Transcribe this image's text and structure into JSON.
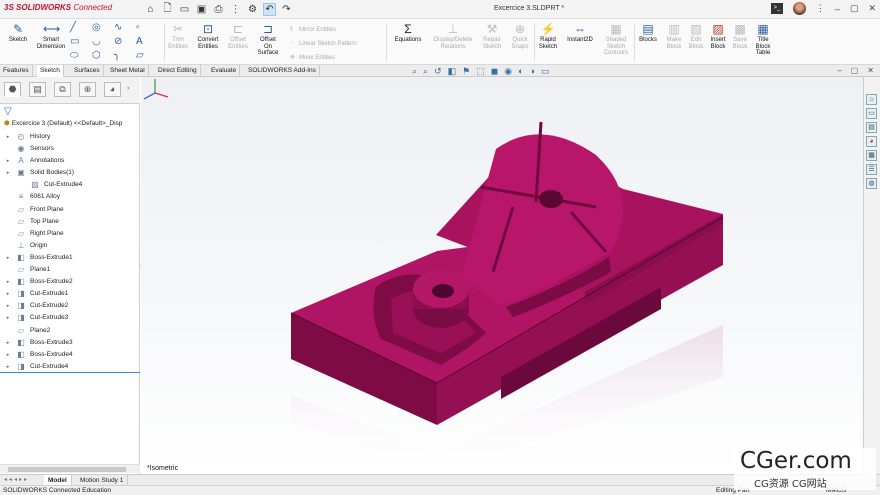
{
  "app": {
    "logo_prefix": "3S",
    "logo_name": "SOLIDWORKS",
    "logo_suffix": "Connected",
    "document_title": "Excercice 3.SLDPRT *"
  },
  "quick_access": [
    "home-icon",
    "new-file-icon",
    "open-icon",
    "save-icon",
    "print-icon",
    "traffic-light-icon",
    "options-icon",
    "undo-icon",
    "redo-icon"
  ],
  "ribbon": {
    "sketch": "Sketch",
    "smart_dimension": "Smart\nDimension",
    "trim": "Trim\nEntities",
    "convert": "Convert\nEntities",
    "offset": "Offset\nEntities",
    "offset_surface": "Offset\nOn\nSurface",
    "mirror": "Mirror Entities",
    "linear_pattern": "Linear Sketch Pattern",
    "move": "Move Entities",
    "equations": "Equations",
    "display_delete": "Display/Delete\nRelations",
    "repair": "Repair\nSketch",
    "quick_snaps": "Quick\nSnaps",
    "rapid_sketch": "Rapid\nSketch",
    "instant2d": "Instant2D",
    "shaded_contours": "Shaded\nSketch\nContours",
    "blocks": "Blocks",
    "make_block": "Make\nBlock",
    "edit_block": "Edit\nBlock",
    "insert_block": "Insert\nBlock",
    "save_block": "Save\nBlock",
    "title_block": "Title\nBlock\nTable"
  },
  "command_tabs": [
    "Features",
    "Sketch",
    "Surfaces",
    "Sheet Metal",
    "Direct Editing",
    "Evaluate",
    "SOLIDWORKS Add-Ins"
  ],
  "active_tab": "Sketch",
  "tree": {
    "root": "Excercice 3 (Default) <<Default>_Disp",
    "items": [
      {
        "label": "History",
        "icon": "history-icon",
        "expand": true,
        "indent": 0
      },
      {
        "label": "Sensors",
        "icon": "sensor-icon",
        "expand": false,
        "indent": 0
      },
      {
        "label": "Annotations",
        "icon": "annotation-icon",
        "expand": true,
        "indent": 0
      },
      {
        "label": "Solid Bodies(1)",
        "icon": "solid-bodies-icon",
        "expand": true,
        "indent": 0
      },
      {
        "label": "Cut-Extrude4",
        "icon": "body-icon",
        "expand": false,
        "indent": 1
      },
      {
        "label": "6061 Alloy",
        "icon": "material-icon",
        "expand": false,
        "indent": 0
      },
      {
        "label": "Front Plane",
        "icon": "plane-icon",
        "expand": false,
        "indent": 0
      },
      {
        "label": "Top Plane",
        "icon": "plane-icon",
        "expand": false,
        "indent": 0
      },
      {
        "label": "Right Plane",
        "icon": "plane-icon",
        "expand": false,
        "indent": 0
      },
      {
        "label": "Origin",
        "icon": "origin-icon",
        "expand": false,
        "indent": 0
      },
      {
        "label": "Boss-Extrude1",
        "icon": "extrude-icon",
        "expand": true,
        "indent": 0
      },
      {
        "label": "Plane1",
        "icon": "plane-icon",
        "expand": false,
        "indent": 0
      },
      {
        "label": "Boss-Extrude2",
        "icon": "extrude-icon",
        "expand": true,
        "indent": 0
      },
      {
        "label": "Cut-Extrude1",
        "icon": "cut-icon",
        "expand": true,
        "indent": 0
      },
      {
        "label": "Cut-Extrude2",
        "icon": "cut-icon",
        "expand": true,
        "indent": 0
      },
      {
        "label": "Cut-Extrude3",
        "icon": "cut-icon",
        "expand": true,
        "indent": 0
      },
      {
        "label": "Plane2",
        "icon": "plane-icon",
        "expand": false,
        "indent": 0
      },
      {
        "label": "Boss-Extrude3",
        "icon": "extrude-icon",
        "expand": true,
        "indent": 0
      },
      {
        "label": "Boss-Extrude4",
        "icon": "extrude-icon",
        "expand": true,
        "indent": 0
      },
      {
        "label": "Cut-Extrude4",
        "icon": "cut-icon",
        "expand": true,
        "indent": 0
      }
    ]
  },
  "viewport": {
    "view_name": "*Isometric",
    "part_color": "#a8125f"
  },
  "bottom_tabs": [
    "Model",
    "Motion Study 1"
  ],
  "status": {
    "left": "SOLIDWORKS Connected Education",
    "mode": "Editing Part",
    "units": "MMGS"
  },
  "watermark": {
    "big": "CGer.com",
    "small": "CG资源 CG网站"
  }
}
